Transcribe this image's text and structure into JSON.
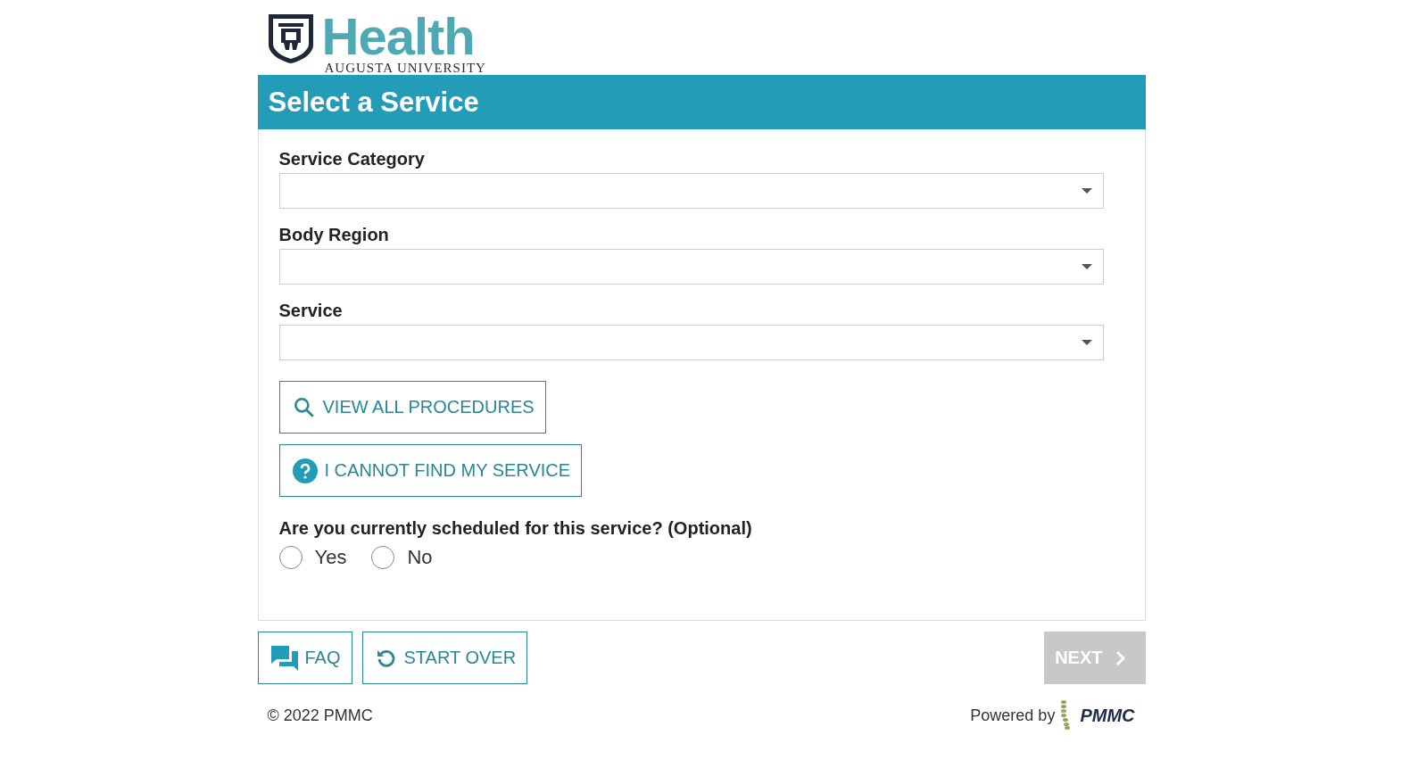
{
  "logo": {
    "title": "Health",
    "subtitle": "AUGUSTA UNIVERSITY"
  },
  "heading": "Select a Service",
  "fields": [
    {
      "label": "Service Category"
    },
    {
      "label": "Body Region"
    },
    {
      "label": "Service"
    }
  ],
  "actions": [
    {
      "kind": "search",
      "label": "VIEW ALL PROCEDURES"
    },
    {
      "kind": "help",
      "label": "I CANNOT FIND MY SERVICE"
    }
  ],
  "question": {
    "label": "Are you currently scheduled for this service? (Optional)",
    "options": [
      {
        "label": "Yes",
        "selected": false
      },
      {
        "label": "No",
        "selected": false
      }
    ]
  },
  "footer_buttons": [
    {
      "kind": "faq",
      "label": "FAQ",
      "disabled": false
    },
    {
      "kind": "restart",
      "label": "START OVER",
      "disabled": false
    },
    {
      "kind": "next",
      "label": "NEXT",
      "disabled": true
    }
  ],
  "copyright": "© 2022 PMMC",
  "powered_by": {
    "text": "Powered by",
    "logo_text": "PMMC"
  }
}
